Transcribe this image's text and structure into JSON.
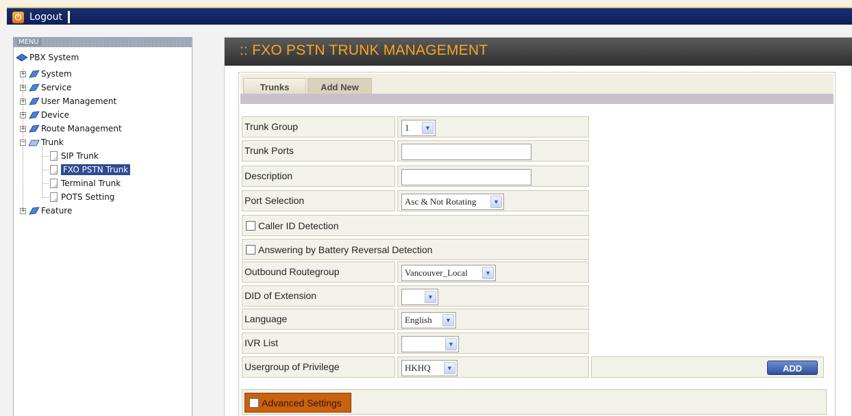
{
  "topbar": {
    "logout_label": "Logout",
    "power_icon": "power-icon"
  },
  "menu": {
    "header": "MENU",
    "root": "PBX System",
    "items": [
      {
        "label": "System"
      },
      {
        "label": "Service"
      },
      {
        "label": "User Management"
      },
      {
        "label": "Device"
      },
      {
        "label": "Route Management"
      },
      {
        "label": "Trunk",
        "children": [
          {
            "label": "SIP Trunk"
          },
          {
            "label": "FXO PSTN Trunk"
          },
          {
            "label": "Terminal Trunk"
          },
          {
            "label": "POTS Setting"
          }
        ]
      },
      {
        "label": "Feature"
      }
    ]
  },
  "main": {
    "title": ":: FXO PSTN TRUNK MANAGEMENT",
    "tabs": [
      {
        "label": "Trunks"
      },
      {
        "label": "Add New"
      }
    ],
    "form": {
      "trunk_group": {
        "label": "Trunk Group",
        "value": "1"
      },
      "trunk_ports": {
        "label": "Trunk Ports",
        "value": ""
      },
      "description": {
        "label": "Description",
        "value": ""
      },
      "port_selection": {
        "label": "Port Selection",
        "value": "Asc & Not Rotating"
      },
      "caller_id": {
        "label": "Caller ID Detection",
        "checked": false
      },
      "battery_reversal": {
        "label": "Answering by Battery Reversal Detection",
        "checked": false
      },
      "outbound_routegroup": {
        "label": "Outbound Routegroup",
        "value": "Vancouver_Local"
      },
      "did_extension": {
        "label": "DID of Extension",
        "value": ""
      },
      "language": {
        "label": "Language",
        "value": "English"
      },
      "ivr_list": {
        "label": "IVR List",
        "value": ""
      },
      "usergroup_privilege": {
        "label": "Usergroup of Privilege",
        "value": "HKHQ"
      },
      "add_label": "ADD",
      "advanced_settings": {
        "label": "Advanced Settings",
        "checked": false
      }
    }
  },
  "colors": {
    "title": "#f5a623",
    "topbar": "#0d1f57",
    "advanced": "#c9610e",
    "selected": "#2e4b8f"
  }
}
